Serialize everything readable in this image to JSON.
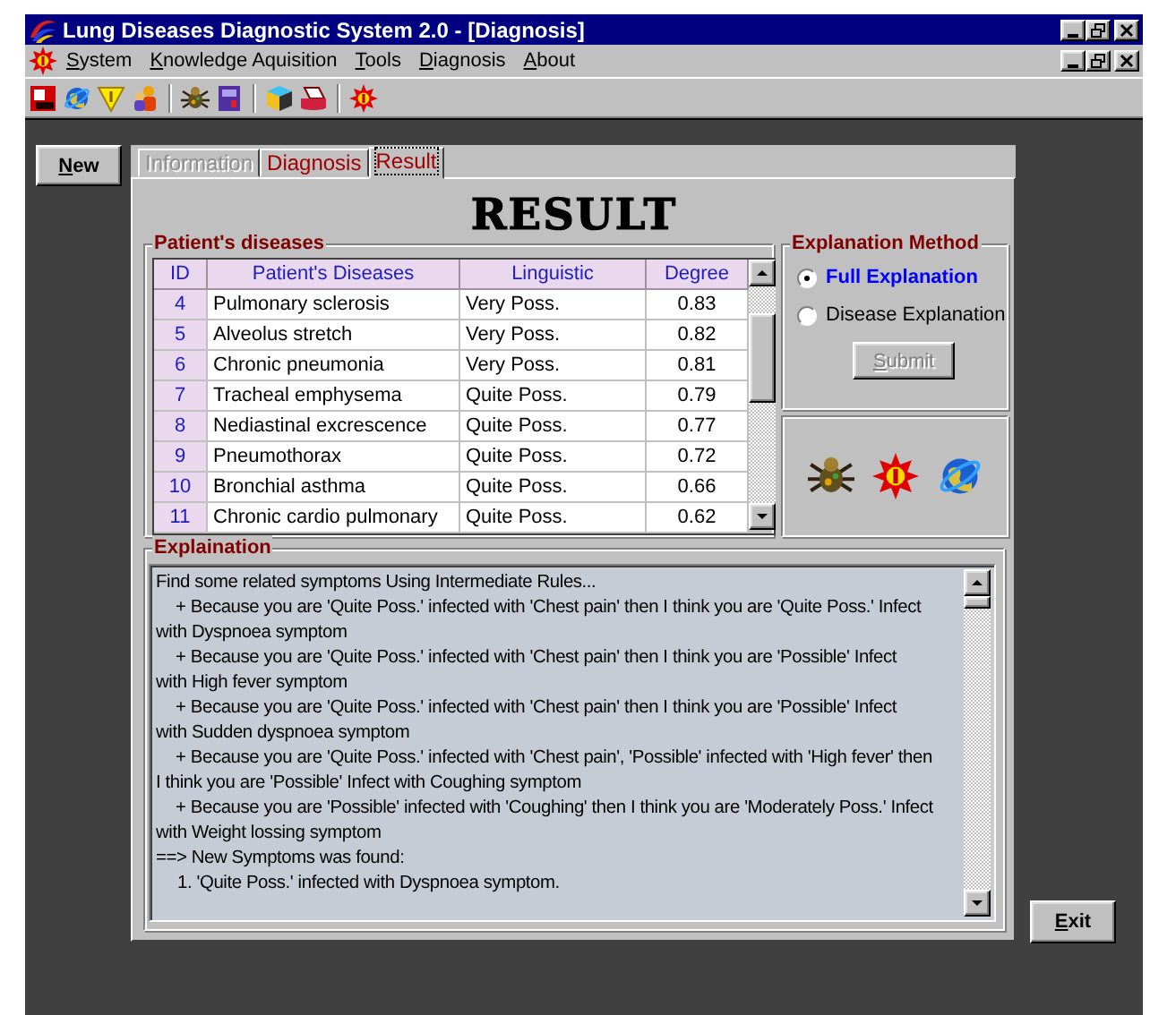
{
  "window": {
    "title": "Lung Diseases Diagnostic System 2.0 - [Diagnosis]"
  },
  "menu": [
    {
      "label": "System"
    },
    {
      "label": "Knowledge Aquisition"
    },
    {
      "label": "Tools"
    },
    {
      "label": "Diagnosis"
    },
    {
      "label": "About"
    }
  ],
  "new_button": {
    "label": "New"
  },
  "tabs": [
    {
      "label": "Information",
      "selected": false,
      "disabled": true
    },
    {
      "label": "Diagnosis",
      "selected": false,
      "disabled": false
    },
    {
      "label": "Result",
      "selected": true,
      "disabled": false
    }
  ],
  "heading": "RESULT",
  "patients_diseases": {
    "title": "Patient's diseases",
    "columns": [
      "ID",
      "Patient's Diseases",
      "Linguistic",
      "Degree"
    ],
    "rows": [
      {
        "id": "4",
        "disease": "Pulmonary sclerosis",
        "linguistic": "Very Poss.",
        "degree": "0.83"
      },
      {
        "id": "5",
        "disease": "Alveolus stretch",
        "linguistic": "Very Poss.",
        "degree": "0.82"
      },
      {
        "id": "6",
        "disease": "Chronic pneumonia",
        "linguistic": "Very Poss.",
        "degree": "0.81"
      },
      {
        "id": "7",
        "disease": "Tracheal emphysema",
        "linguistic": "Quite Poss.",
        "degree": "0.79"
      },
      {
        "id": "8",
        "disease": "Nediastinal excrescence",
        "linguistic": "Quite Poss.",
        "degree": "0.77"
      },
      {
        "id": "9",
        "disease": "Pneumothorax",
        "linguistic": "Quite Poss.",
        "degree": "0.72"
      },
      {
        "id": "10",
        "disease": "Bronchial asthma",
        "linguistic": "Quite Poss.",
        "degree": "0.66"
      },
      {
        "id": "11",
        "disease": "Chronic cardio pulmonary",
        "linguistic": "Quite Poss.",
        "degree": "0.62"
      }
    ]
  },
  "explanation_method": {
    "title": "Explanation Method",
    "options": [
      {
        "label": "Full Explanation",
        "selected": true
      },
      {
        "label": "Disease Explanation",
        "selected": false
      }
    ],
    "submit": {
      "label": "Submit",
      "disabled": true
    }
  },
  "explanation": {
    "title": "Explaination",
    "lines": [
      {
        "kind": "text",
        "text": "Find some related symptoms Using Intermediate Rules..."
      },
      {
        "kind": "rule",
        "text": "+ Because you are 'Quite Poss.' infected with 'Chest pain' then I think you are 'Quite Poss.' Infect"
      },
      {
        "kind": "text",
        "text": "with Dyspnoea symptom"
      },
      {
        "kind": "rule",
        "text": "+ Because you are 'Quite Poss.' infected with 'Chest pain' then I think you are 'Possible' Infect"
      },
      {
        "kind": "text",
        "text": "with High fever symptom"
      },
      {
        "kind": "rule",
        "text": "+ Because you are 'Quite Poss.' infected with 'Chest pain' then I think you are 'Possible' Infect"
      },
      {
        "kind": "text",
        "text": "with Sudden dyspnoea symptom"
      },
      {
        "kind": "rule",
        "text": "+ Because you are 'Quite Poss.' infected with 'Chest pain', 'Possible' infected with 'High fever' then"
      },
      {
        "kind": "text",
        "text": "I think you are 'Possible' Infect with Coughing symptom"
      },
      {
        "kind": "rule",
        "text": "+ Because you are 'Possible' infected with 'Coughing' then I think you are 'Moderately Poss.' Infect"
      },
      {
        "kind": "text",
        "text": "with Weight lossing symptom"
      },
      {
        "kind": "text",
        "text": "==> New Symptoms was found:"
      },
      {
        "kind": "item",
        "text": "1. 'Quite Poss.' infected with Dyspnoea symptom."
      }
    ]
  },
  "exit_button": {
    "label": "Exit"
  }
}
